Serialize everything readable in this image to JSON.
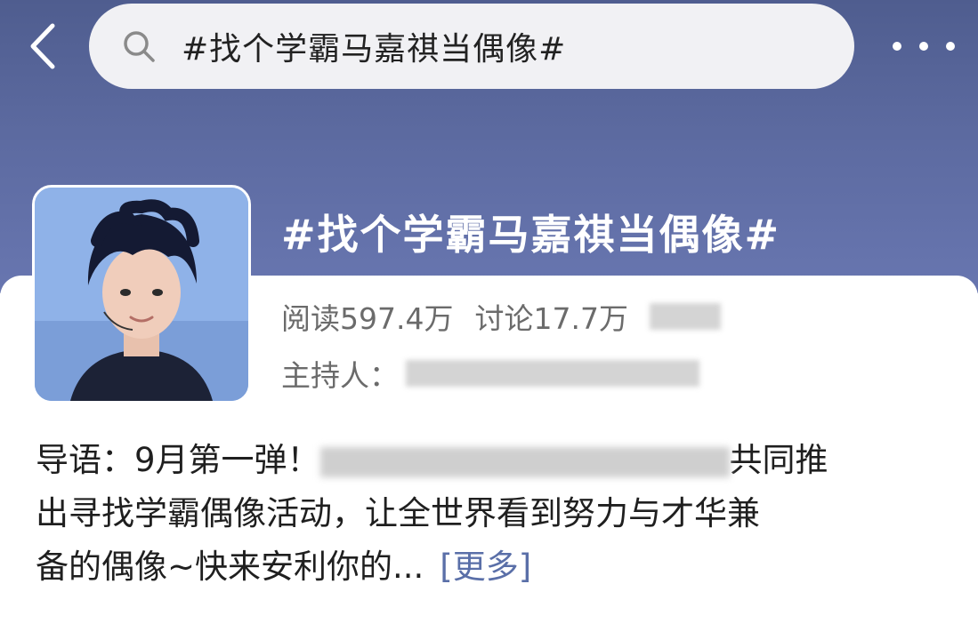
{
  "search": {
    "query": "#找个学霸马嘉祺当偶像#"
  },
  "topic": {
    "title": "#找个学霸马嘉祺当偶像#",
    "read_label": "阅读597.4万",
    "discuss_label": "讨论17.7万",
    "host_label": "主持人："
  },
  "intro": {
    "line1_prefix": "导语：9月第一弹！",
    "line1_suffix": "共同推",
    "line2": "出寻找学霸偶像活动，让全世界看到努力与才华兼",
    "line3": "备的偶像~快来安利你的...",
    "more_link": "[更多]"
  },
  "icons": [
    "back-arrow-icon",
    "search-icon",
    "more-dots-icon"
  ],
  "colors": {
    "header": "#5c6aa0",
    "link": "#5a6fa8"
  }
}
